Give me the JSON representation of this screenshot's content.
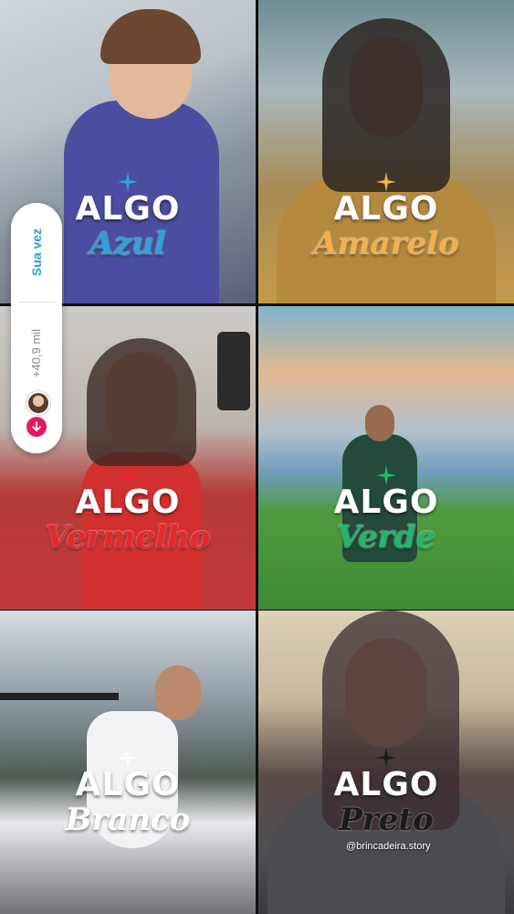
{
  "tiles": [
    {
      "algo": "ALGO",
      "color_word": "Azul",
      "color": "#2aa3de",
      "star_color": "#2aa3de",
      "bg": "linear-gradient(160deg,#cfd7dc 0%,#b9c2c8 35%,#8a94a0 60%,#5a5f7a 100%)"
    },
    {
      "algo": "ALGO",
      "color_word": "Amarelo",
      "color": "#f2b24a",
      "star_color": "#f2b24a",
      "bg": "linear-gradient(180deg,#6f8d96 0%,#a9b9bd 30%,#a88b55 62%,#c49a47 100%)"
    },
    {
      "algo": "ALGO",
      "color_word": "Vermelho",
      "color": "#e8262b",
      "star_color": "#e8262b",
      "bg": "linear-gradient(180deg,#cfcac6 0%,#bdb5ae 40%,#b43a36 62%,#c2383a 100%)"
    },
    {
      "algo": "ALGO",
      "color_word": "Verde",
      "color": "#1fb96a",
      "star_color": "#1fb96a",
      "bg": "linear-gradient(180deg,#7fb3cf 0%,#e2b98f 22%,#b0c0cf 42%,#6f9cba 55%,#4f9b3f 68%,#3f8a34 100%)"
    },
    {
      "algo": "ALGO",
      "color_word": "Branco",
      "color": "#ffffff",
      "star_color": "#ffffff",
      "bg": "linear-gradient(180deg,#d7dde2 0%,#8e9aa3 30%,#4e5a52 55%,#e9eaed 70%,#707276 100%)"
    },
    {
      "algo": "ALGO",
      "color_word": "Preto",
      "color": "#1a1a1a",
      "star_color": "#1a1a1a",
      "bg": "linear-gradient(180deg,#ded1b8 0%,#c8b69a 30%,#5b4a48 55%,#4e4e52 80%,#3a3a3e 100%)"
    }
  ],
  "handle": "@brincadeira.story",
  "pill": {
    "label": "Sua vez",
    "count": "+40,9 mil"
  }
}
